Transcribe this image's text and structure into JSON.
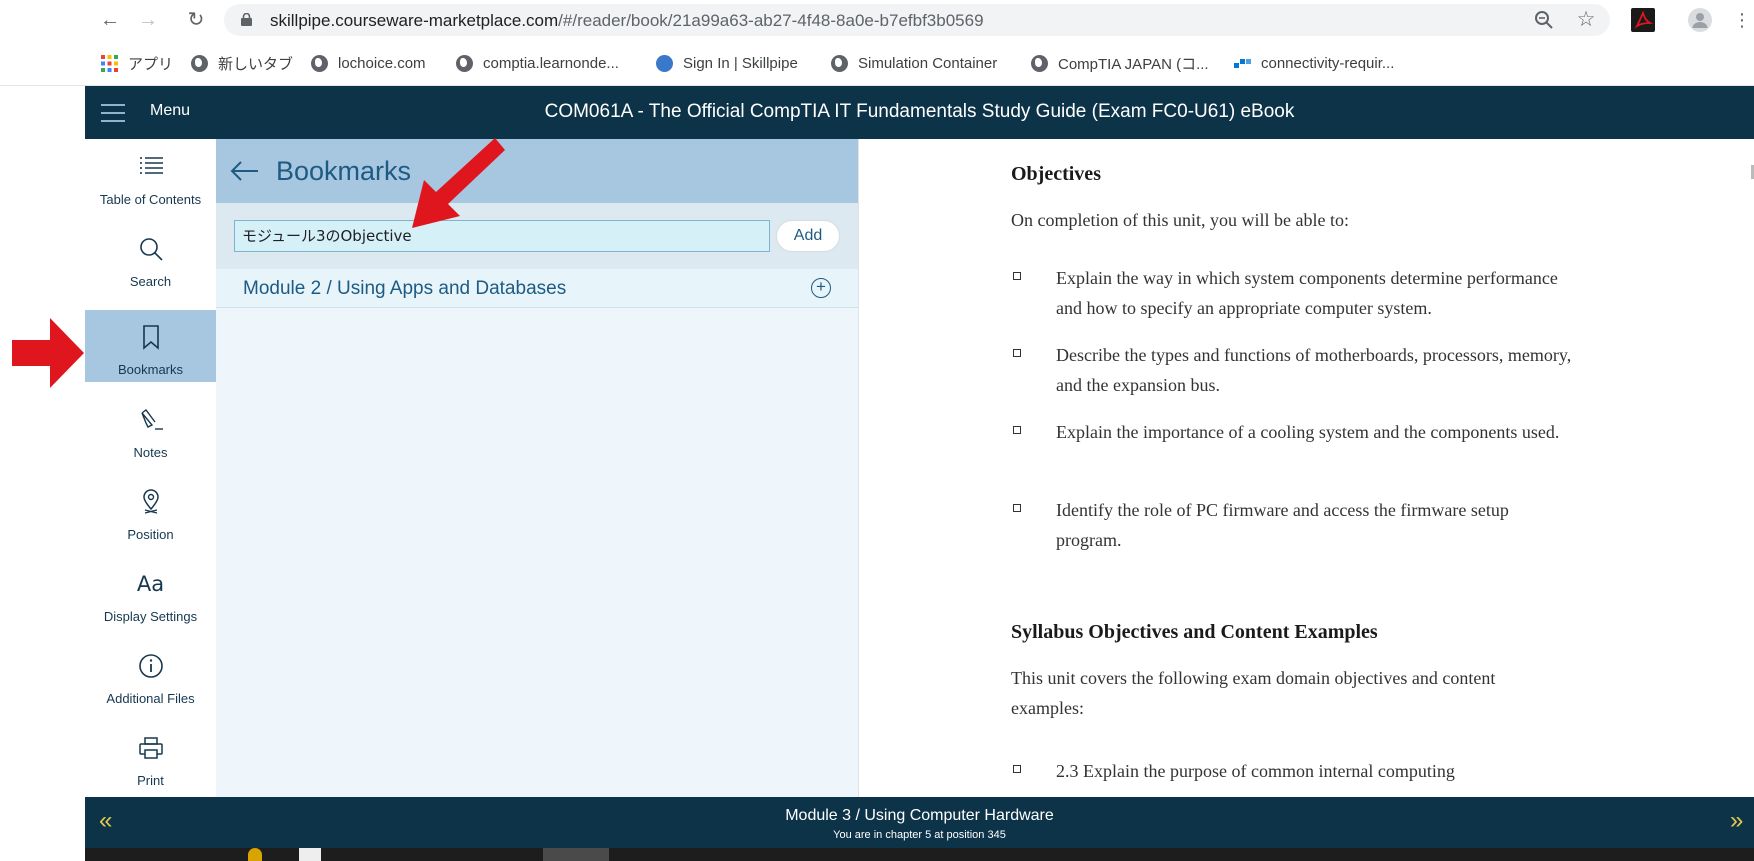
{
  "browser": {
    "url_host": "skillpipe.courseware-marketplace.com",
    "url_path": "/#/reader/book/21a99a63-ab27-4f48-8a0e-b7efbf3b0569",
    "bookmarks_bar": [
      {
        "label": "アプリ",
        "icon": "apps-grid-icon"
      },
      {
        "label": "新しいタブ",
        "icon": "globe-icon"
      },
      {
        "label": "lochoice.com",
        "icon": "globe-icon"
      },
      {
        "label": "comptia.learnonde...",
        "icon": "globe-icon"
      },
      {
        "label": "Sign In | Skillpipe",
        "icon": "skillpipe-icon"
      },
      {
        "label": "Simulation Container",
        "icon": "globe-icon"
      },
      {
        "label": "CompTIA JAPAN (コ...",
        "icon": "globe-icon"
      },
      {
        "label": "connectivity-requir...",
        "icon": "azure-icon"
      }
    ]
  },
  "header": {
    "menu_label": "Menu",
    "book_title": "COM061A - The Official CompTIA IT Fundamentals Study Guide (Exam FC0-U61) eBook"
  },
  "side_nav": [
    {
      "label": "Table of Contents",
      "icon": "list-icon"
    },
    {
      "label": "Search",
      "icon": "search-icon"
    },
    {
      "label": "Bookmarks",
      "icon": "bookmark-icon",
      "active": true
    },
    {
      "label": "Notes",
      "icon": "pen-icon"
    },
    {
      "label": "Position",
      "icon": "location-pin-icon"
    },
    {
      "label": "Display Settings",
      "icon": "font-size-icon"
    },
    {
      "label": "Additional Files",
      "icon": "info-icon"
    },
    {
      "label": "Print",
      "icon": "printer-icon"
    }
  ],
  "bookmarks_panel": {
    "title": "Bookmarks",
    "input_value": "モジュール3のObjective",
    "add_label": "Add",
    "items": [
      {
        "label": "Module 2 / Using Apps and Databases"
      }
    ]
  },
  "reader": {
    "objectives_heading": "Objectives",
    "intro": "On completion of this unit, you will be able to:",
    "objectives": [
      "Explain the way in which system components determine performance and how to specify an appropriate computer system.",
      "Describe the types and functions of motherboards, processors, memory, and the expansion bus.",
      "Explain the importance of a cooling system and the components used.",
      "Identify the role of PC firmware and access the firmware setup program."
    ],
    "syllabus_heading": "Syllabus Objectives and Content Examples",
    "syllabus_intro": "This unit covers the following exam domain objectives and content examples:",
    "syllabus_items": [
      "2.3 Explain the purpose of common internal computing"
    ]
  },
  "footer": {
    "chapter_title": "Module 3 / Using Computer Hardware",
    "position_text": "You are in chapter 5 at position 345",
    "prev_label": "«",
    "next_label": "»"
  },
  "colors": {
    "header_bg": "#0d3349",
    "active_nav_bg": "#a7c6df",
    "panel_bg": "#eef6fb",
    "annotation_red": "#e0161e"
  }
}
